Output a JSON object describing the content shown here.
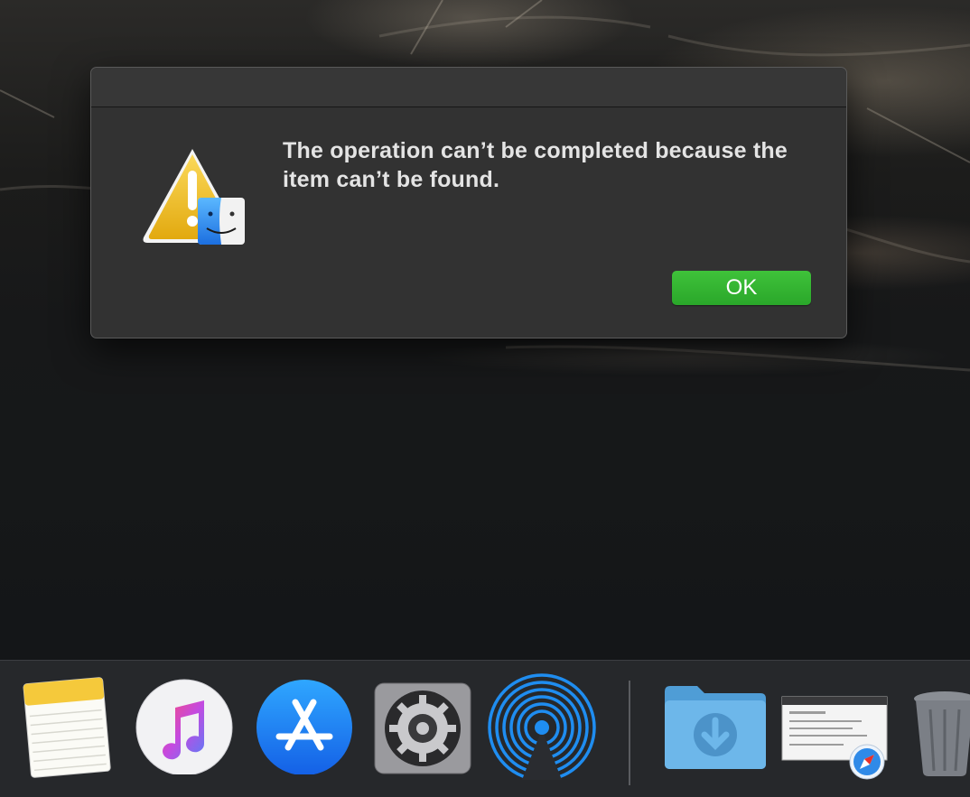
{
  "dialog": {
    "message": "The operation can’t be completed because the item can’t be found.",
    "ok_label": "OK",
    "icon": "warning-finder-icon"
  },
  "dock": {
    "items": [
      {
        "name": "Notes",
        "icon": "notes-icon"
      },
      {
        "name": "iTunes",
        "icon": "itunes-icon"
      },
      {
        "name": "App Store",
        "icon": "app-store-icon"
      },
      {
        "name": "System Preferences",
        "icon": "system-preferences-icon"
      },
      {
        "name": "AirDrop",
        "icon": "airdrop-icon"
      },
      {
        "name": "Downloads",
        "icon": "downloads-folder-icon"
      },
      {
        "name": "Safari Window",
        "icon": "safari-window-icon"
      },
      {
        "name": "Trash",
        "icon": "trash-icon"
      }
    ]
  },
  "colors": {
    "ok_button": "#2fb02f",
    "dialog_bg": "#323232",
    "dock_bg": "#2a2c30"
  }
}
